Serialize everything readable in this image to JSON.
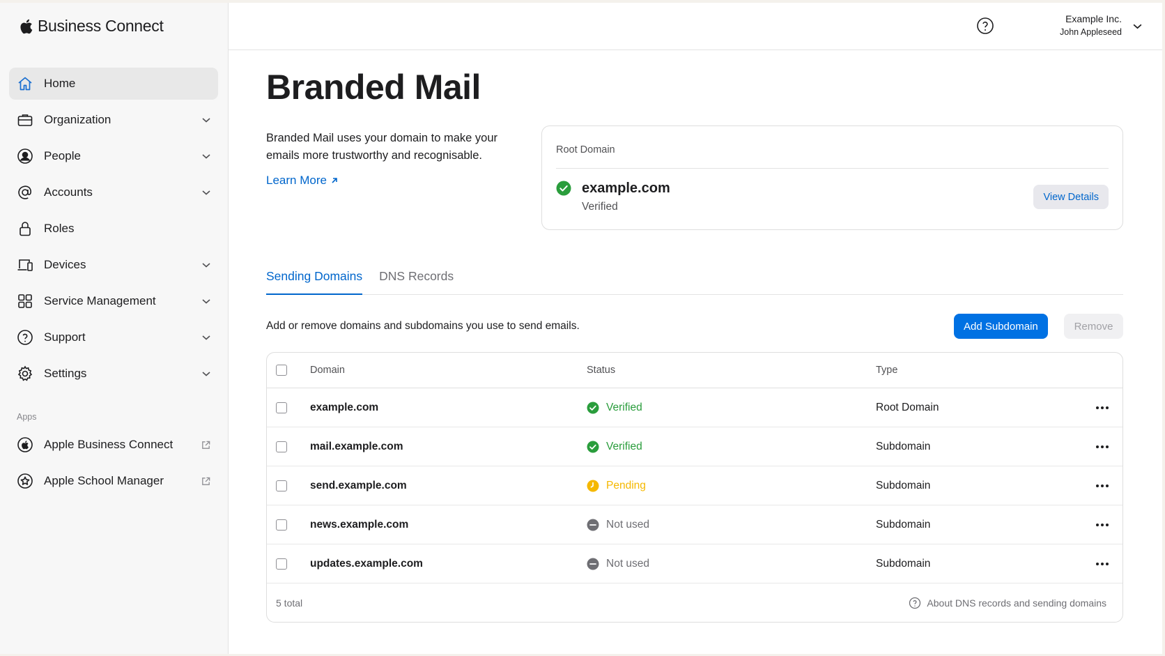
{
  "app": {
    "brand": "Business Connect"
  },
  "sidebar": {
    "items": [
      {
        "label": "Home",
        "icon": "home-icon",
        "active": true,
        "has_chevron": false
      },
      {
        "label": "Organization",
        "icon": "briefcase-icon",
        "has_chevron": true
      },
      {
        "label": "People",
        "icon": "person-circle-icon",
        "has_chevron": true
      },
      {
        "label": "Accounts",
        "icon": "at-sign-icon",
        "has_chevron": true
      },
      {
        "label": "Roles",
        "icon": "lock-icon",
        "has_chevron": false
      },
      {
        "label": "Devices",
        "icon": "laptop-phone-icon",
        "has_chevron": true
      },
      {
        "label": "Service Management",
        "icon": "grid-icon",
        "has_chevron": true
      },
      {
        "label": "Support",
        "icon": "question-circle-icon",
        "has_chevron": true
      },
      {
        "label": "Settings",
        "icon": "gear-icon",
        "has_chevron": true
      }
    ],
    "apps_label": "Apps",
    "apps": [
      {
        "label": "Apple Business Connect",
        "icon": "apple-circle-icon"
      },
      {
        "label": "Apple School Manager",
        "icon": "star-circle-icon"
      }
    ]
  },
  "header": {
    "org_name": "Example Inc.",
    "user_name": "John Appleseed",
    "help_icon": "question-circle-icon"
  },
  "page": {
    "title": "Branded Mail",
    "intro": "Branded Mail uses your domain to make your emails more trustworthy and recognisable.",
    "learn_more": "Learn More"
  },
  "root_domain": {
    "label": "Root Domain",
    "domain": "example.com",
    "status": "Verified",
    "view_details": "View Details"
  },
  "tabs": [
    {
      "label": "Sending Domains",
      "active": true
    },
    {
      "label": "DNS Records",
      "active": false
    }
  ],
  "sending_domains": {
    "description": "Add or remove domains and subdomains you use to send emails.",
    "add_label": "Add Subdomain",
    "remove_label": "Remove",
    "columns": {
      "domain": "Domain",
      "status": "Status",
      "type": "Type"
    },
    "rows": [
      {
        "domain": "example.com",
        "status": "Verified",
        "status_kind": "verified",
        "type": "Root Domain"
      },
      {
        "domain": "mail.example.com",
        "status": "Verified",
        "status_kind": "verified",
        "type": "Subdomain"
      },
      {
        "domain": "send.example.com",
        "status": "Pending",
        "status_kind": "pending",
        "type": "Subdomain"
      },
      {
        "domain": "news.example.com",
        "status": "Not used",
        "status_kind": "notused",
        "type": "Subdomain"
      },
      {
        "domain": "updates.example.com",
        "status": "Not used",
        "status_kind": "notused",
        "type": "Subdomain"
      }
    ],
    "total": "5 total",
    "about_link": "About DNS records and sending domains"
  },
  "colors": {
    "accent": "#0071e3",
    "link": "#0066cc",
    "verified": "#2a9d3c",
    "pending": "#f5b800",
    "not_used": "#6e6e73"
  }
}
